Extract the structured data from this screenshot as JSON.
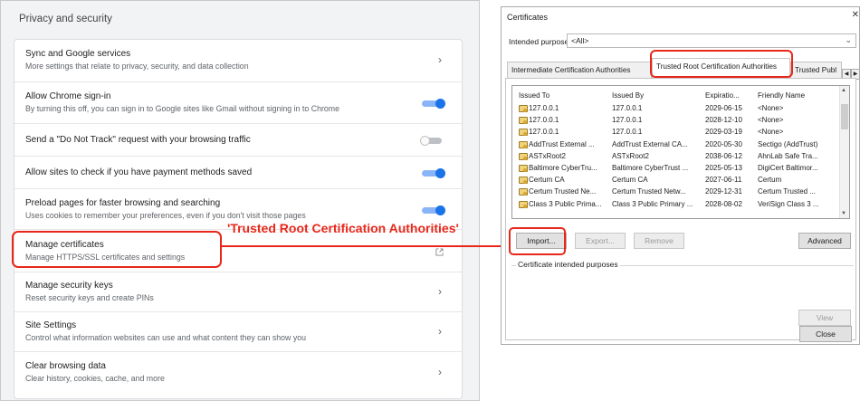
{
  "settings": {
    "section_title": "Privacy and security",
    "rows": [
      {
        "title": "Sync and Google services",
        "subtitle": "More settings that relate to privacy, security, and data collection",
        "control": "chevron"
      },
      {
        "title": "Allow Chrome sign-in",
        "subtitle": "By turning this off, you can sign in to Google sites like Gmail without signing in to Chrome",
        "control": "toggle-on"
      },
      {
        "title": "Send a \"Do Not Track\" request with your browsing traffic",
        "subtitle": "",
        "control": "toggle-off"
      },
      {
        "title": "Allow sites to check if you have payment methods saved",
        "subtitle": "",
        "control": "toggle-on"
      },
      {
        "title": "Preload pages for faster browsing and searching",
        "subtitle": "Uses cookies to remember your preferences, even if you don't visit those pages",
        "control": "toggle-on"
      },
      {
        "title": "Manage certificates",
        "subtitle": "Manage HTTPS/SSL certificates and settings",
        "control": "external"
      },
      {
        "title": "Manage security keys",
        "subtitle": "Reset security keys and create PINs",
        "control": "chevron"
      },
      {
        "title": "Site Settings",
        "subtitle": "Control what information websites can use and what content they can show you",
        "control": "chevron"
      },
      {
        "title": "Clear browsing data",
        "subtitle": "Clear history, cookies, cache, and more",
        "control": "chevron"
      }
    ],
    "chevron_glyph": "›",
    "toggle_on_color": "#1a73e8"
  },
  "annotation": {
    "text": "'Trusted Root Certification Authorities'",
    "color": "#e8271a"
  },
  "dialog": {
    "title": "Certificates",
    "close_glyph": "✕",
    "purpose_label": "Intended purpose:",
    "purpose_value": "<All>",
    "tabs": [
      "Intermediate Certification Authorities",
      "Trusted Root Certification Authorities",
      "Trusted Publ"
    ],
    "tab_scroll_left": "◀",
    "tab_scroll_right": "▶",
    "columns": [
      "Issued To",
      "Issued By",
      "Expiratio...",
      "Friendly Name"
    ],
    "certificates": [
      [
        "127.0.0.1",
        "127.0.0.1",
        "2029-06-15",
        "<None>"
      ],
      [
        "127.0.0.1",
        "127.0.0.1",
        "2028-12-10",
        "<None>"
      ],
      [
        "127.0.0.1",
        "127.0.0.1",
        "2029-03-19",
        "<None>"
      ],
      [
        "AddTrust External ...",
        "AddTrust External CA...",
        "2020-05-30",
        "Sectigo (AddTrust)"
      ],
      [
        "ASTxRoot2",
        "ASTxRoot2",
        "2038-06-12",
        "AhnLab Safe Tra..."
      ],
      [
        "Baltimore CyberTru...",
        "Baltimore CyberTrust ...",
        "2025-05-13",
        "DigiCert Baltimor..."
      ],
      [
        "Certum CA",
        "Certum CA",
        "2027-06-11",
        "Certum"
      ],
      [
        "Certum Trusted Ne...",
        "Certum Trusted Netw...",
        "2029-12-31",
        "Certum Trusted ..."
      ],
      [
        "Class 3 Public Prima...",
        "Class 3 Public Primary ...",
        "2028-08-02",
        "VeriSign Class 3 ..."
      ]
    ],
    "buttons": {
      "import": "Import...",
      "export": "Export...",
      "remove": "Remove",
      "advanced": "Advanced",
      "view": "View",
      "close": "Close"
    },
    "purposes_label": "Certificate intended purposes"
  }
}
